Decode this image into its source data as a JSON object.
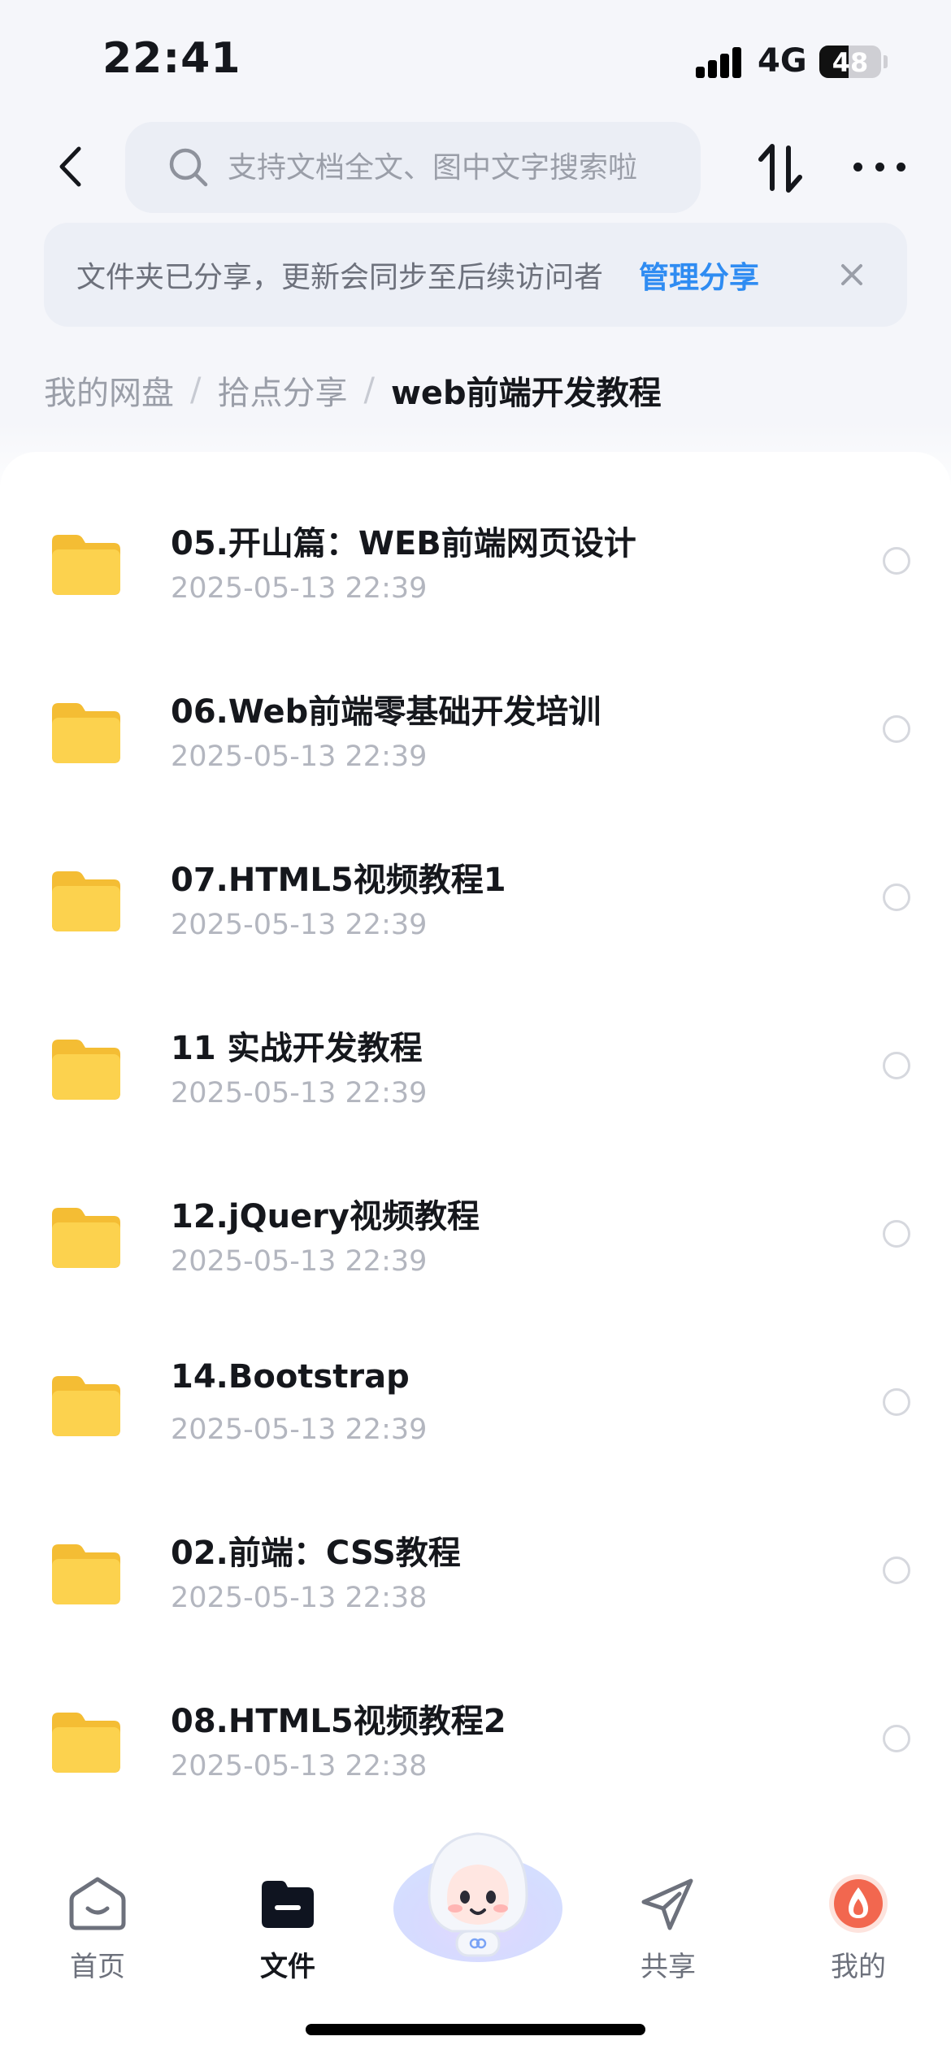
{
  "status_bar": {
    "time": "22:41",
    "network": "4G",
    "battery": "48",
    "battery_level": 0.48
  },
  "header": {
    "back_icon": "chevron-left-icon",
    "search": {
      "placeholder": "支持文档全文、图中文字搜索啦",
      "value": ""
    },
    "sort_icon": "sort-arrows-icon",
    "more_icon": "more-dots-icon"
  },
  "share_banner": {
    "message": "文件夹已分享，更新会同步至后续访问者",
    "action_label": "管理分享",
    "close_icon": "close-icon"
  },
  "breadcrumb": {
    "items": [
      "我的网盘",
      "拾点分享"
    ],
    "separator": "/",
    "current": "web前端开发教程"
  },
  "files": [
    {
      "name": "05.开山篇：WEB前端网页设计",
      "date": "2025-05-13 22:39"
    },
    {
      "name": "06.Web前端零基础开发培训",
      "date": "2025-05-13 22:39"
    },
    {
      "name": "07.HTML5视频教程1",
      "date": "2025-05-13 22:39"
    },
    {
      "name": "11 实战开发教程",
      "date": "2025-05-13 22:39"
    },
    {
      "name": "12.jQuery视频教程",
      "date": "2025-05-13 22:39"
    },
    {
      "name": "14.Bootstrap",
      "date": "2025-05-13 22:39"
    },
    {
      "name": "02.前端：CSS教程",
      "date": "2025-05-13 22:38"
    },
    {
      "name": "08.HTML5视频教程2",
      "date": "2025-05-13 22:38"
    }
  ],
  "tabbar": {
    "items": [
      {
        "label": "首页",
        "icon": "home-face-icon"
      },
      {
        "label": "文件",
        "icon": "folder-icon",
        "active": true
      },
      {
        "label": "",
        "icon": "mascot-icon"
      },
      {
        "label": "共享",
        "icon": "paper-plane-icon"
      },
      {
        "label": "我的",
        "icon": "profile-drop-icon"
      }
    ]
  },
  "colors": {
    "accent": "#2f8cf2",
    "folder": "#fcd24e",
    "text_primary": "#15171c",
    "text_secondary": "#b3b6bf"
  }
}
